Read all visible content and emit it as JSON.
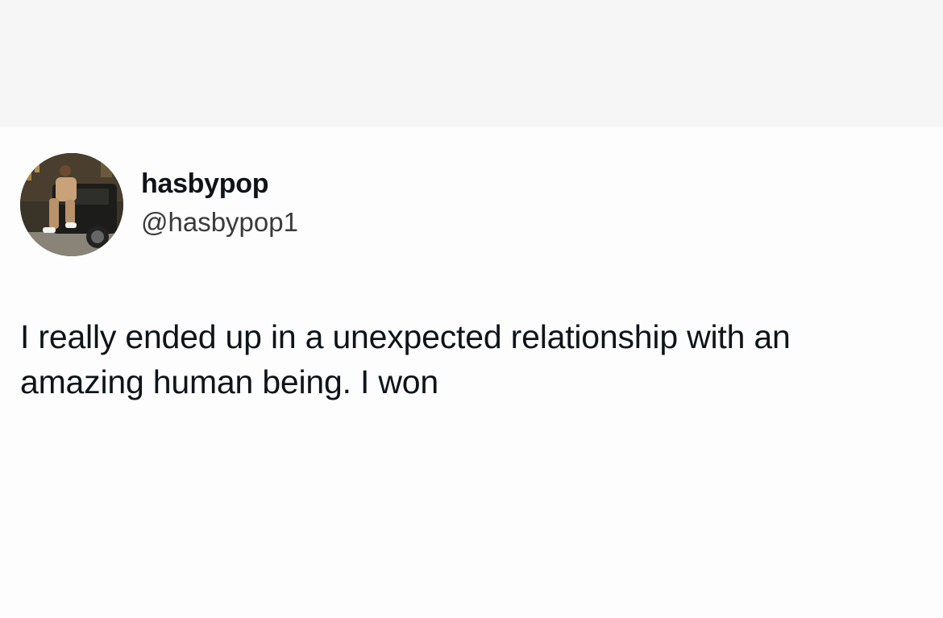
{
  "tweet": {
    "author": {
      "display_name": "hasbypop",
      "handle": "@hasbypop1",
      "avatar_icon": "profile-photo"
    },
    "text": "I really ended up in a unexpected relationship with an amazing human being. I won"
  },
  "colors": {
    "background": "#fdfdfd",
    "top_band": "#f6f6f6",
    "text_primary": "#0f1419",
    "text_secondary": "#3a3a3a"
  }
}
